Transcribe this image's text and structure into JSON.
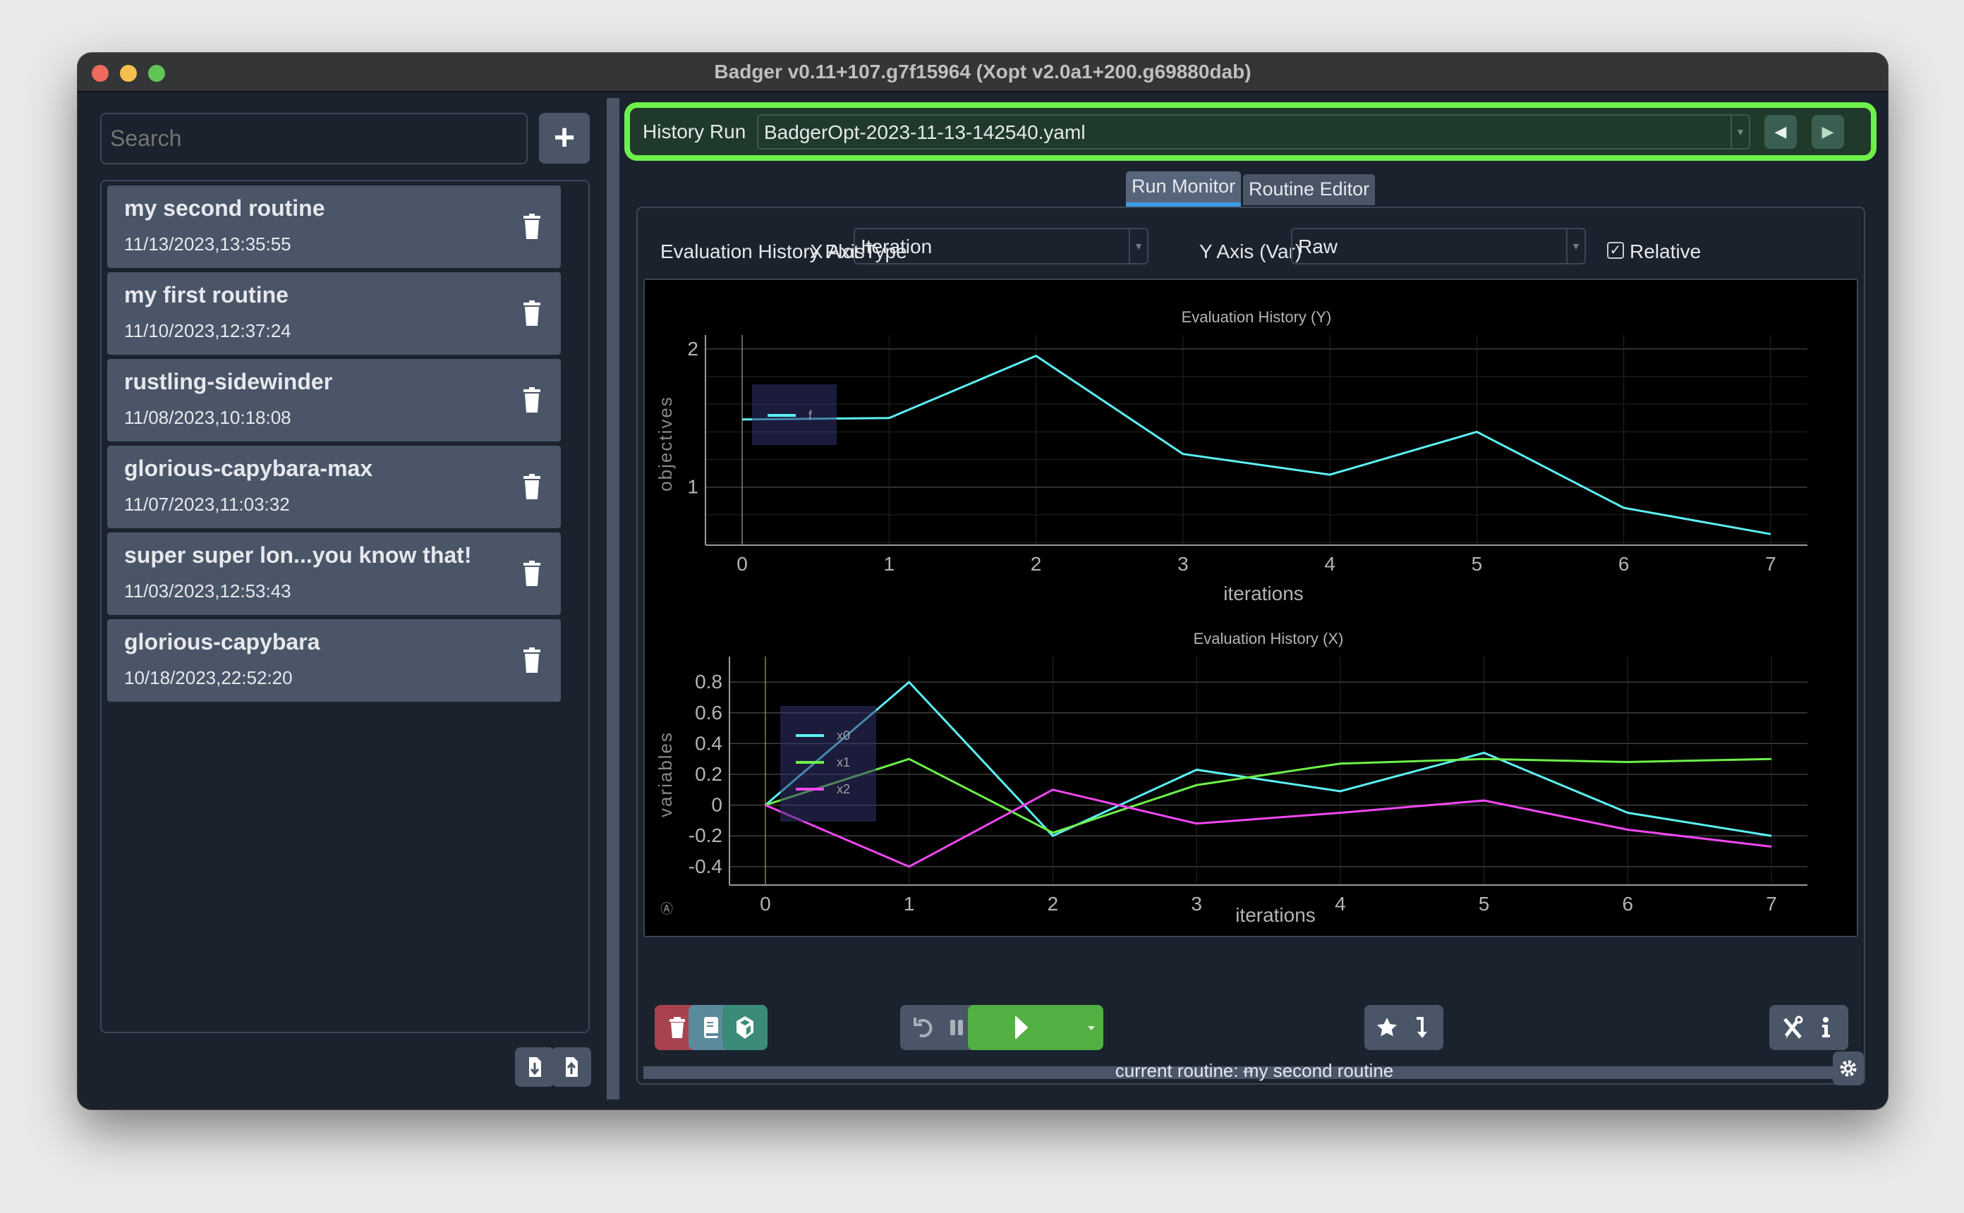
{
  "window": {
    "title": "Badger v0.11+107.g7f15964 (Xopt v2.0a1+200.g69880dab)"
  },
  "sidebar": {
    "search_placeholder": "Search",
    "add_label": "+",
    "routines": [
      {
        "name": "my second routine",
        "date": "11/13/2023,13:35:55"
      },
      {
        "name": "my first routine",
        "date": "11/10/2023,12:37:24"
      },
      {
        "name": "rustling-sidewinder",
        "date": "11/08/2023,10:18:08"
      },
      {
        "name": "glorious-capybara-max",
        "date": "11/07/2023,11:03:32"
      },
      {
        "name": "super super lon...you know that!",
        "date": "11/03/2023,12:53:43"
      },
      {
        "name": "glorious-capybara",
        "date": "10/18/2023,22:52:20"
      }
    ],
    "import_icon": "file-import-icon",
    "export_icon": "file-export-icon"
  },
  "history": {
    "label": "History Run",
    "selected": "BadgerOpt-2023-11-13-142540.yaml",
    "prev_icon": "caret-left-icon",
    "next_icon": "caret-right-icon",
    "highlight_color": "#6ef04a"
  },
  "tabs": [
    {
      "label": "Run Monitor",
      "active": true
    },
    {
      "label": "Routine Editor",
      "active": false
    }
  ],
  "controls": {
    "plot_type_label": "Evaluation History Plot Type",
    "x_axis_label": "X Axis",
    "x_axis_value": "Iteration",
    "y_axis_label": "Y Axis (Var)",
    "y_axis_value": "Raw",
    "relative_label": "Relative",
    "relative_checked": true
  },
  "toolbar": {
    "delete_icon": "trash-icon",
    "logbook_icon": "book-icon",
    "environment_icon": "cube-icon",
    "reset_icon": "undo-icon",
    "pause_icon": "pause-icon",
    "run_icon": "play-icon",
    "jump_best_icon": "star-icon",
    "dial_in_icon": "arrow-down-icon",
    "tools_icon": "tools-icon",
    "info_icon": "info-icon",
    "colors": {
      "delete": "#a8424f",
      "logbook": "#5a8a9c",
      "environment": "#3b8a7a",
      "run": "#52b043",
      "neutral": "#4a5568"
    }
  },
  "status": {
    "text": "current routine: my second routine"
  },
  "chart_data": [
    {
      "type": "line",
      "title": "Evaluation History (Y)",
      "xlabel": "iterations",
      "ylabel": "objectives",
      "x": [
        0,
        1,
        2,
        3,
        4,
        5,
        6,
        7
      ],
      "xlim": [
        -0.25,
        7.25
      ],
      "ylim": [
        0.58,
        2.05
      ],
      "yticks": [
        1,
        2
      ],
      "xticks": [
        0,
        1,
        2,
        3,
        4,
        5,
        6,
        7
      ],
      "grid": true,
      "legend_position": "top-left",
      "series": [
        {
          "name": "f",
          "color": "#5cf2f5",
          "values": [
            1.49,
            1.5,
            1.95,
            1.24,
            1.09,
            1.4,
            0.85,
            0.66
          ]
        }
      ]
    },
    {
      "type": "line",
      "title": "Evaluation History (X)",
      "xlabel": "iterations",
      "ylabel": "variables",
      "x": [
        0,
        1,
        2,
        3,
        4,
        5,
        6,
        7
      ],
      "xlim": [
        -0.25,
        7.25
      ],
      "ylim": [
        -0.52,
        0.92
      ],
      "yticks": [
        -0.4,
        -0.2,
        0,
        0.2,
        0.4,
        0.6,
        0.8
      ],
      "ytick_labels": [
        "-0.4",
        "-0.2",
        "0",
        "0.2",
        "0.4",
        "0.6",
        "0.8"
      ],
      "xticks": [
        0,
        1,
        2,
        3,
        4,
        5,
        6,
        7
      ],
      "grid": true,
      "legend_position": "top-left",
      "series": [
        {
          "name": "x0",
          "color": "#5cf2f5",
          "values": [
            0,
            0.8,
            -0.2,
            0.23,
            0.09,
            0.34,
            -0.05,
            -0.2
          ]
        },
        {
          "name": "x1",
          "color": "#6ef04a",
          "values": [
            0,
            0.3,
            -0.18,
            0.13,
            0.27,
            0.3,
            0.28,
            0.3
          ]
        },
        {
          "name": "x2",
          "color": "#f247f2",
          "values": [
            0,
            -0.4,
            0.1,
            -0.12,
            -0.05,
            0.03,
            -0.16,
            -0.27
          ]
        }
      ]
    }
  ]
}
